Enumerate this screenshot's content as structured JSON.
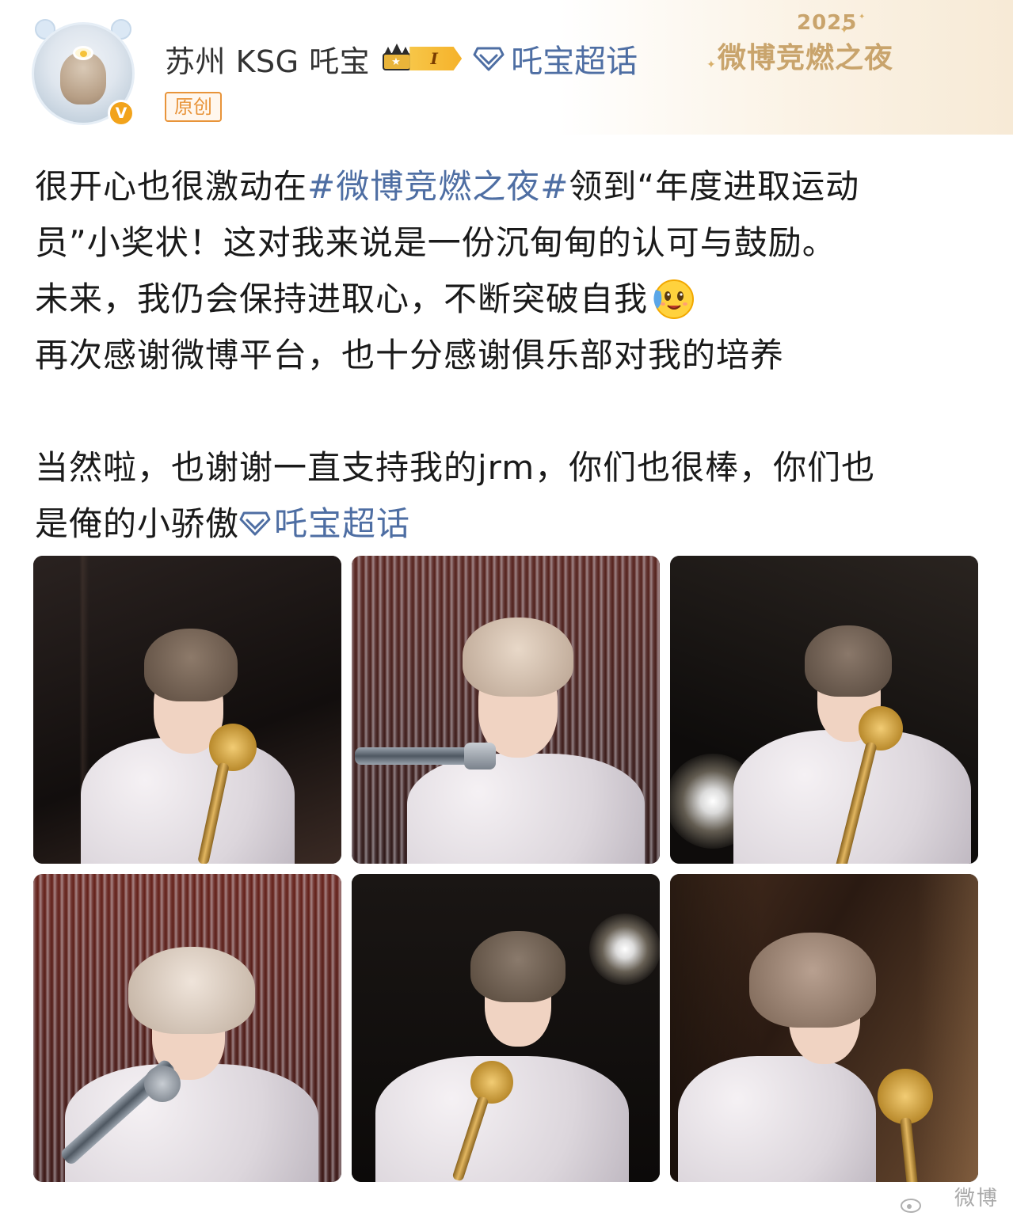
{
  "header": {
    "user_name": "苏州 KSG 吒宝",
    "vip_level": "I",
    "supertopic_label": "吒宝超话",
    "original_tag": "原创",
    "verified_mark": "V",
    "event_logo": {
      "year": "2025",
      "title": "微博竞燃之夜"
    }
  },
  "post": {
    "line1_pre": "很开心也很激动在",
    "line1_hashtag": "#微博竞燃之夜#",
    "line1_post": "领到“年度进取运动",
    "line2": "员”小奖状！这对我来说是一份沉甸甸的认可与鼓励。",
    "line3": "未来，我仍会保持进取心，不断突破自我",
    "line4": "再次感谢微博平台，也十分感谢俱乐部对我的培养",
    "line5": "当然啦，也谢谢一直支持我的jrm，你们也很棒，你们也",
    "line6_pre": "是俺的小骄傲",
    "line6_topic": "吒宝超话"
  },
  "photos": [
    {
      "description": "photo-1"
    },
    {
      "description": "photo-2"
    },
    {
      "description": "photo-3"
    },
    {
      "description": "photo-4"
    },
    {
      "description": "photo-5"
    },
    {
      "description": "photo-6"
    }
  ],
  "watermark": "微博",
  "colors": {
    "link": "#4e6ea3",
    "original_tag": "#e8943a",
    "vip_gold": "#f5b22a",
    "event_gold": "#c9a46c"
  },
  "icons": {
    "avatar": "avatar-icon",
    "verified": "verified-badge-icon",
    "crown": "crown-icon",
    "supertopic": "diamond-icon",
    "emoji": "crying-smile-emoji-icon"
  }
}
